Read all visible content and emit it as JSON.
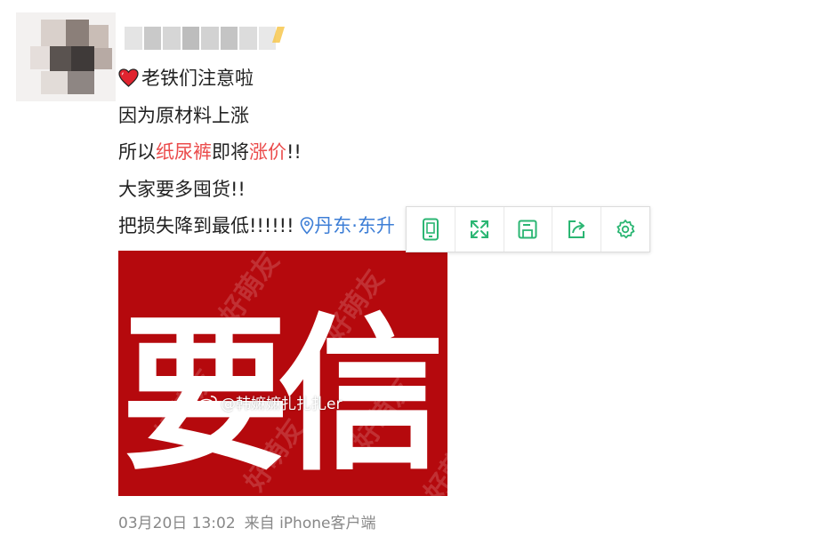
{
  "post": {
    "lines": [
      "老铁们注意啦",
      "因为原材料上涨"
    ],
    "line3": {
      "before": "所以",
      "hl1": "纸尿裤",
      "mid": "即将",
      "hl2": "涨价",
      "after": "!!"
    },
    "line4": "大家要多囤货!!",
    "line5": "把损失降到最低!!!!!!",
    "location": "丹东·东升",
    "highlight_color": "#eb4c4c",
    "link_color": "#3d7ed6"
  },
  "toolbar": {
    "icons": [
      "mobile-icon",
      "fullscreen-icon",
      "save-icon",
      "share-icon",
      "settings-icon"
    ],
    "icon_color": "#2bb673"
  },
  "image": {
    "chars": [
      "要",
      "信"
    ],
    "watermark": "好萌友",
    "weibo_watermark": "@韩嫲嫲扎扎扎er",
    "bg_color": "#b5090d"
  },
  "meta": {
    "timestamp": "03月20日 13:02",
    "source": "来自 iPhone客户端"
  }
}
